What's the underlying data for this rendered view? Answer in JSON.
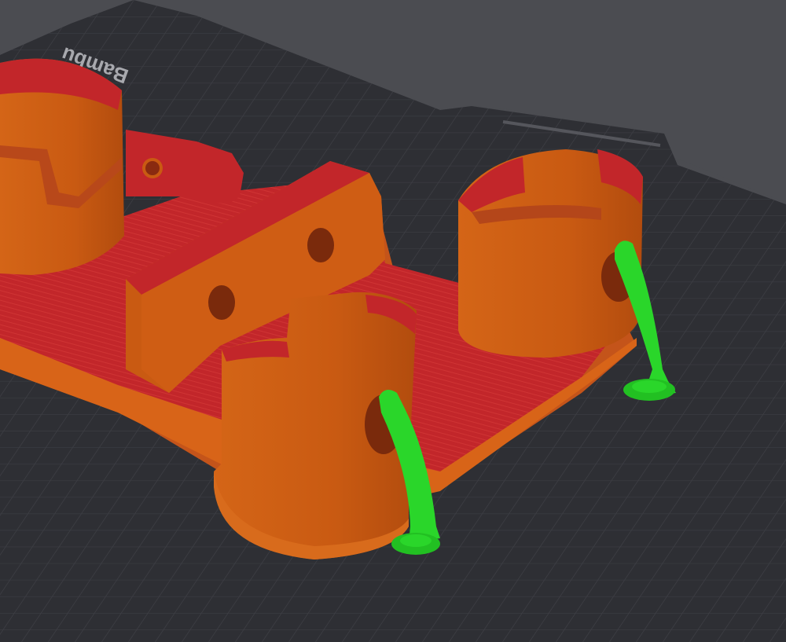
{
  "viewport": {
    "background_color": "#4b4c51",
    "plate_color": "#2d2e33",
    "grid_color": "#3b3c42"
  },
  "build_plate": {
    "brand_label": "Bambu",
    "logo_icon": "bambu-logo-icon"
  },
  "model": {
    "body_color": "#cc5a14",
    "infill_color": "#c2262a",
    "support_color": "#2ad62a",
    "support_count": 2,
    "cup_count": 3
  }
}
